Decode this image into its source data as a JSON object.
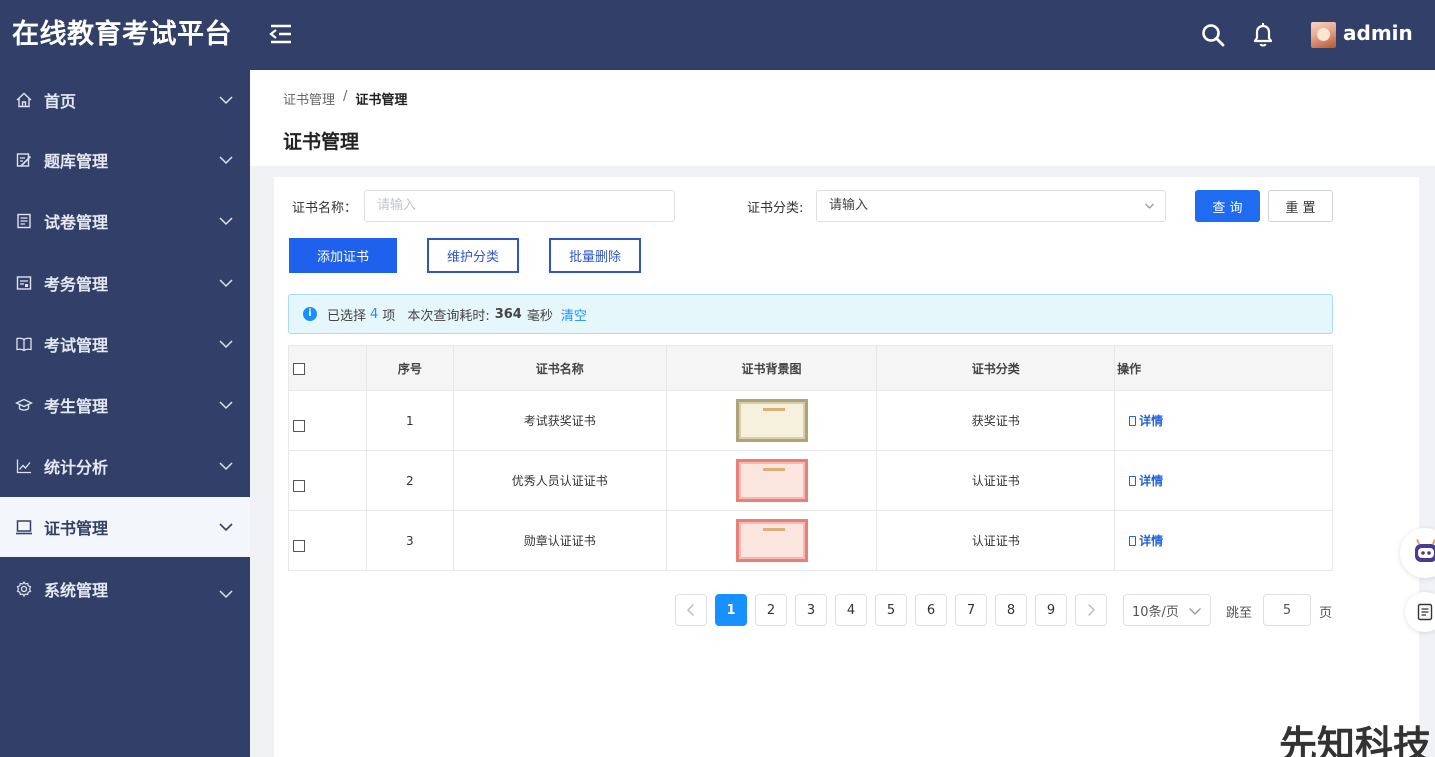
{
  "app": {
    "title": "在线教育考试平台"
  },
  "sidebar": {
    "items": [
      {
        "label": "首页",
        "icon": "home-icon"
      },
      {
        "label": "题库管理",
        "icon": "edit-icon"
      },
      {
        "label": "试卷管理",
        "icon": "paper-icon"
      },
      {
        "label": "考务管理",
        "icon": "form-icon"
      },
      {
        "label": "考试管理",
        "icon": "book-icon"
      },
      {
        "label": "考生管理",
        "icon": "graduation-cap-icon"
      },
      {
        "label": "统计分析",
        "icon": "line-chart-icon"
      },
      {
        "label": "证书管理",
        "icon": "laptop-icon",
        "active": true
      },
      {
        "label": "系统管理",
        "icon": "gear-icon"
      }
    ]
  },
  "topbar": {
    "username": "admin"
  },
  "header": {
    "breadcrumb": [
      "证书管理",
      "证书管理"
    ],
    "breadcrumb_sep": "/",
    "title": "证书管理"
  },
  "filters": {
    "name_label": "证书名称：",
    "name_placeholder": "请输入",
    "category_label": "证书分类:",
    "category_value": "请输入",
    "query_button": "查 询",
    "reset_button": "重 置"
  },
  "actions": {
    "add": "添加证书",
    "maintain": "维护分类",
    "batch_delete": "批量删除"
  },
  "info": {
    "selected_prefix": "已选择",
    "selected_count": "4",
    "selected_suffix": "项",
    "time_prefix": "本次查询耗时:",
    "time_value": "364",
    "time_unit": "毫秒",
    "clear": "清空"
  },
  "table": {
    "columns": [
      "序号",
      "证书名称",
      "证书背景图",
      "证书分类",
      "操作"
    ],
    "rows": [
      {
        "index": "1",
        "name": "考试获奖证书",
        "category": "获奖证书",
        "action": "详情",
        "thumb": "gold"
      },
      {
        "index": "2",
        "name": "优秀人员认证证书",
        "category": "认证证书",
        "action": "详情",
        "thumb": "red"
      },
      {
        "index": "3",
        "name": "勋章认证证书",
        "category": "认证证书",
        "action": "详情",
        "thumb": "red"
      }
    ]
  },
  "pagination": {
    "pages": [
      "1",
      "2",
      "3",
      "4",
      "5",
      "6",
      "7",
      "8",
      "9"
    ],
    "current": "1",
    "page_size": "10条/页",
    "jump_label": "跳至",
    "jump_value": "5",
    "page_unit": "页"
  },
  "watermark": "先知科技",
  "colors": {
    "sidebar": "#324069",
    "primary": "#1f6cf3",
    "link": "#1890ff"
  }
}
